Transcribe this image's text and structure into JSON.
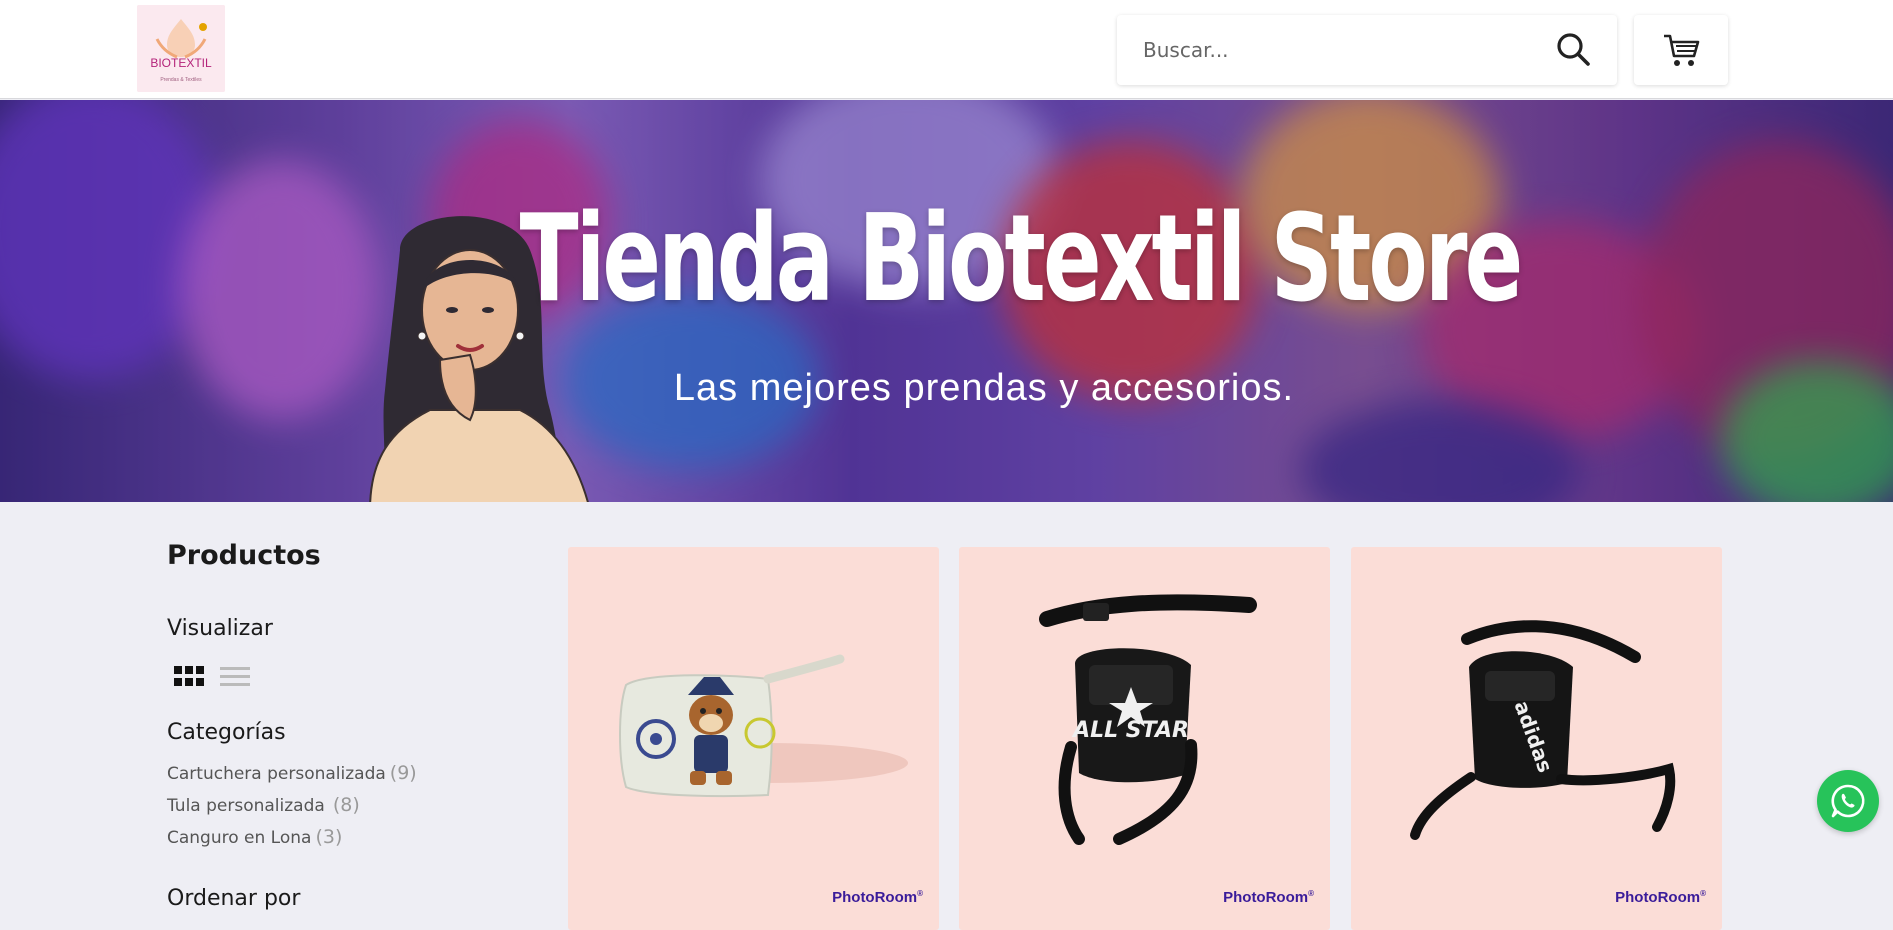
{
  "header": {
    "logo": {
      "text": "BIOTEXTIL",
      "subtext": "Prendas & Textiles"
    },
    "search": {
      "placeholder": "Buscar..."
    },
    "icons": {
      "search": "search-icon",
      "cart": "cart-icon"
    }
  },
  "hero": {
    "title": "Tienda Biotextil Store",
    "subtitle": "Las mejores prendas y accesorios."
  },
  "sidebar": {
    "title": "Productos",
    "view_label": "Visualizar",
    "view_options": [
      "grid-view-icon",
      "list-view-icon"
    ],
    "categories_label": "Categorías",
    "categories": [
      {
        "name": "Cartuchera personalizada",
        "count": "(9)"
      },
      {
        "name": "Tula personalizada",
        "count": "(8)"
      },
      {
        "name": "Canguro en Lona",
        "count": "(3)"
      }
    ],
    "sort_label": "Ordenar por"
  },
  "products": [
    {
      "watermark": "PhotoRoom",
      "image": "paw-patrol-pencil-case"
    },
    {
      "watermark": "PhotoRoom",
      "image": "all-star-leg-bag"
    },
    {
      "watermark": "PhotoRoom",
      "image": "adidas-leg-bag"
    }
  ],
  "colors": {
    "accent_purple": "#3a1c9a",
    "card_bg": "#fbddd7",
    "page_bg": "#eeeef4",
    "whatsapp": "#27c35a"
  }
}
